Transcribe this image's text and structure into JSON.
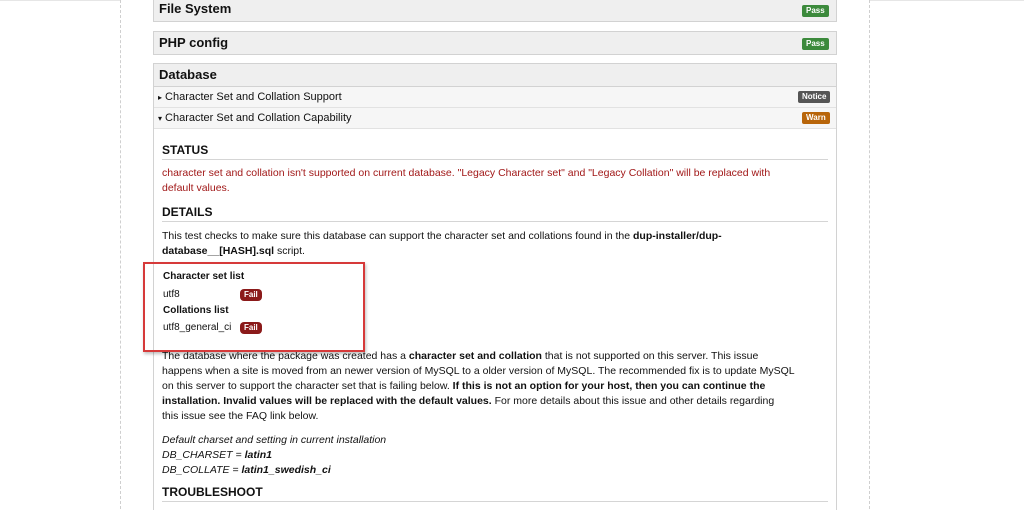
{
  "sections": [
    {
      "title": "File System",
      "badge": "Pass"
    },
    {
      "title": "PHP config",
      "badge": "Pass"
    }
  ],
  "database": {
    "title": "Database",
    "rows": [
      {
        "label": "Character Set and Collation Support",
        "badge": "Notice",
        "arrow": "▸"
      },
      {
        "label": "Character Set and Collation Capability",
        "badge": "Warn",
        "arrow": "▾"
      }
    ],
    "status_title": "STATUS",
    "status_line1": "character set and collation isn't supported on current database. \"Legacy Character set\" and \"Legacy Collation\" will be replaced with",
    "status_line2": "default values.",
    "details_title": "DETAILS",
    "details_line1_pre": "This test checks to make sure this database can support the character set and collations found in the ",
    "details_line1_bold": "dup-installer/dup-",
    "details_line2_bold": "database__[HASH].sql",
    "details_line2_post": " script.",
    "charset_list_title": "Character set list",
    "charset_item": "utf8",
    "charset_badge": "Fail",
    "collations_title": "Collations list",
    "collation_item": "utf8_general_ci",
    "collation_badge": "Fail",
    "para_l1_pre": "The database where the package was created has a ",
    "para_l1_bold": "character set and collation",
    "para_l1_post": " that is not supported on this server. This issue",
    "para_l2": "happens when a site is moved from an newer version of MySQL to a older version of MySQL. The recommended fix is to update MySQL",
    "para_l3_pre": "on this server to support the character set that is failing below. ",
    "para_l3_bold": "If this is not an option for your host, then you can continue the",
    "para_l4_bold": "installation. Invalid values will be replaced with the default values.",
    "para_l4_post": " For more details about this issue and other details regarding",
    "para_l5": "this issue see the FAQ link below.",
    "default_intro": "Default charset and setting in current installation",
    "charset_key": "DB_CHARSET = ",
    "charset_val": "latin1",
    "collate_key": "DB_COLLATE = ",
    "collate_val": "latin1_swedish_ci",
    "troubleshoot_title": "TROUBLESHOOT"
  }
}
